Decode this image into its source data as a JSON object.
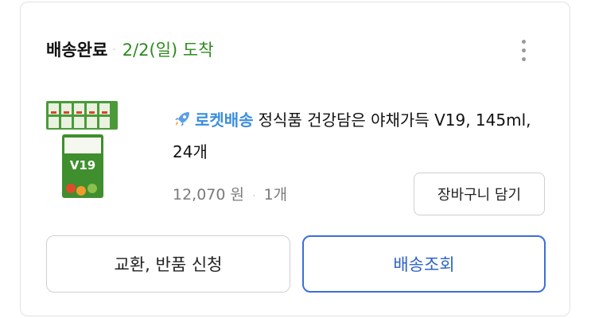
{
  "order": {
    "status": "배송완료",
    "separator": "·",
    "arrival": "2/2(일) 도착"
  },
  "more_icon": "more-vertical-icon",
  "product": {
    "image_icon": "juice-box-pack-image",
    "badge_icon": "rocket-icon",
    "badge_label": "로켓배송",
    "title": "정식품 건강담은 야채가득 V19, 145ml, 24개",
    "price": "12,070 원",
    "price_separator": "·",
    "quantity": "1개"
  },
  "buttons": {
    "add_to_cart": "장바구니 담기",
    "exchange_return": "교환, 반품 신청",
    "track_delivery": "배송조회"
  },
  "colors": {
    "arrival_green": "#2e8b1f",
    "rocket_blue": "#3a8ede",
    "track_blue": "#2d63c8",
    "border_gray": "#cfcfcf"
  }
}
